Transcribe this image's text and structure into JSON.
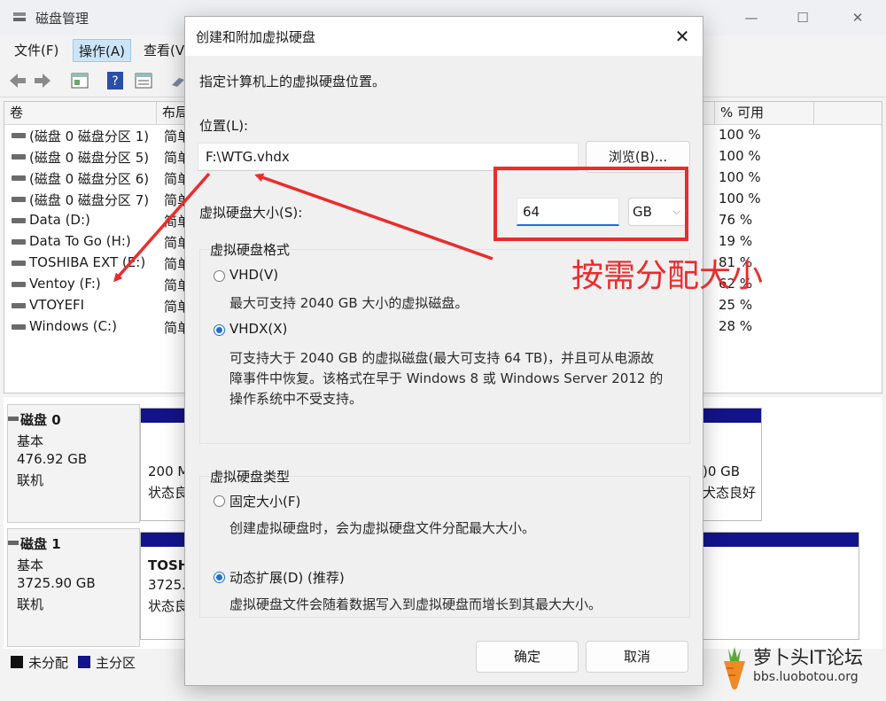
{
  "main_window": {
    "title": "磁盘管理",
    "controls": {
      "minimize": "—",
      "maximize": "☐",
      "close": "✕"
    },
    "menu": {
      "file": "文件(F)",
      "action": "操作(A)",
      "view": "查看(V"
    },
    "columns": {
      "volume": "卷",
      "layout": "布局",
      "percent_free": "% 可用"
    },
    "volumes": [
      {
        "name": "(磁盘 0 磁盘分区 1)",
        "layout": "简单",
        "percent_free": "100 %"
      },
      {
        "name": "(磁盘 0 磁盘分区 5)",
        "layout": "简单",
        "percent_free": "100 %"
      },
      {
        "name": "(磁盘 0 磁盘分区 6)",
        "layout": "简单",
        "percent_free": "100 %"
      },
      {
        "name": "(磁盘 0 磁盘分区 7)",
        "layout": "简单",
        "percent_free": "100 %"
      },
      {
        "name": "Data (D:)",
        "layout": "简单",
        "percent_free": "76 %"
      },
      {
        "name": "Data To Go (H:)",
        "layout": "简单",
        "percent_free": "19 %"
      },
      {
        "name": "TOSHIBA EXT (E:)",
        "layout": "简单",
        "percent_free": "81 %"
      },
      {
        "name": "Ventoy (F:)",
        "layout": "简单",
        "percent_free": "62 %"
      },
      {
        "name": "VTOYEFI",
        "layout": "简单",
        "percent_free": "25 %"
      },
      {
        "name": "Windows (C:)",
        "layout": "简单",
        "percent_free": "28 %"
      }
    ],
    "disks": [
      {
        "name": "磁盘 0",
        "type": "基本",
        "size": "476.92 GB",
        "status": "联机",
        "left_partition": {
          "line1": "200 M",
          "line2": "状态良"
        },
        "right_partition": {
          "line1": ")0 GB",
          "line2": "犬态良好 ("
        }
      },
      {
        "name": "磁盘 1",
        "type": "基本",
        "size": "3725.90 GB",
        "status": "联机",
        "left_partition": {
          "line1": "TOSH",
          "line2": "3725.",
          "line3": "状态良"
        }
      }
    ],
    "legend": {
      "unallocated": "未分配",
      "primary": "主分区"
    }
  },
  "dialog": {
    "title": "创建和附加虚拟硬盘",
    "close": "✕",
    "instruction": "指定计算机上的虚拟硬盘位置。",
    "location_label": "位置(L):",
    "location_value": "F:\\WTG.vhdx",
    "browse_button": "浏览(B)...",
    "size_label": "虚拟硬盘大小(S):",
    "size_value": "64",
    "size_unit": "GB",
    "format_group": {
      "title": "虚拟硬盘格式",
      "vhd": {
        "label": "VHD(V)",
        "desc": "最大可支持 2040 GB 大小的虚拟磁盘。",
        "checked": false
      },
      "vhdx": {
        "label": "VHDX(X)",
        "desc_lines": [
          "可支持大于 2040 GB 的虚拟磁盘(最大可支持 64 TB)，并且可从电源故",
          "障事件中恢复。该格式在早于 Windows 8 或 Windows Server 2012 的",
          "操作系统中不受支持。"
        ],
        "checked": true
      }
    },
    "type_group": {
      "title": "虚拟硬盘类型",
      "fixed": {
        "label": "固定大小(F)",
        "desc": "创建虚拟硬盘时，会为虚拟硬盘文件分配最大大小。",
        "checked": false
      },
      "dynamic": {
        "label": "动态扩展(D) (推荐)",
        "desc": "虚拟硬盘文件会随着数据写入到虚拟硬盘而增长到其最大大小。",
        "checked": true
      }
    },
    "ok_button": "确定",
    "cancel_button": "取消"
  },
  "annotation": {
    "text": "按需分配大小",
    "color": "#ec2b2b"
  },
  "watermark": {
    "title": "萝卜头IT论坛",
    "url": "bbs.luobotou.org"
  },
  "colors": {
    "accent": "#1f6ed8",
    "partition_bar": "#13138b",
    "annotation": "#ec2b2b"
  }
}
